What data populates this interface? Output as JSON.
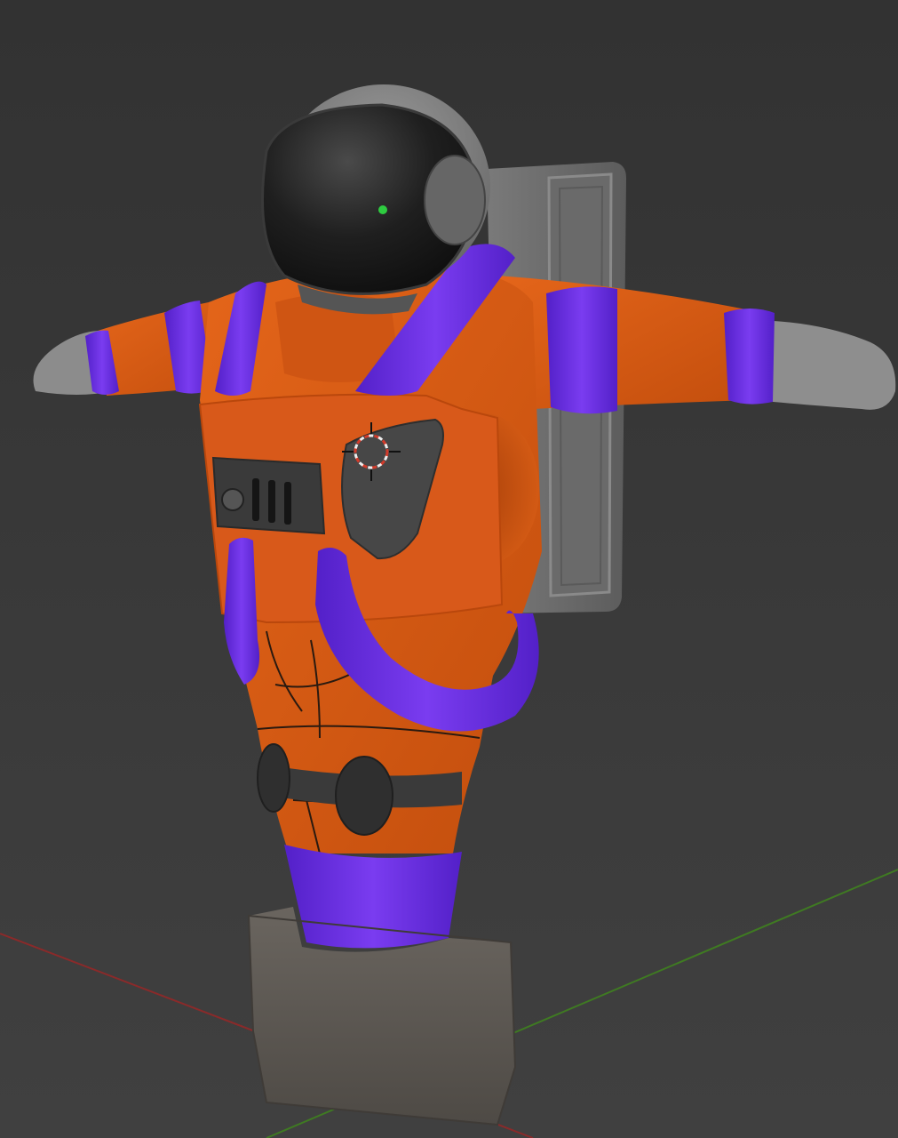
{
  "viewport": {
    "background_color": "#3a3a3a",
    "background_gradient_top": "#323232",
    "background_gradient_bottom": "#404040",
    "mode": "3d-viewport-solid-shading"
  },
  "axes": {
    "x_axis_color": "#8a2a2a",
    "y_axis_color": "#3f7a22"
  },
  "model": {
    "name": "astronaut",
    "colors": {
      "suit": "#d95a12",
      "suit_shadow": "#b8460b",
      "hoses": "#6a2ee0",
      "hoses_dark": "#4a1ab8",
      "helmet_shell": "#7d7d7d",
      "visor": "#1a1a1a",
      "gloves": "#8a8a8a",
      "backpack": "#6e6e6e",
      "chest_panel": "#3c3c3c",
      "base_block": "#5a5550"
    }
  },
  "overlays": {
    "origin_dot_color": "#2ecc40",
    "cursor_ring_color": "#d23b2b",
    "cursor_icon": "3d-cursor-icon",
    "origin_icon": "object-origin-icon"
  }
}
